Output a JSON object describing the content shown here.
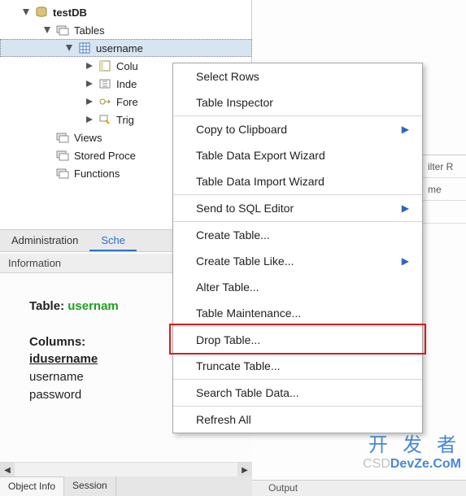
{
  "tree": {
    "db": "testDB",
    "tables_label": "Tables",
    "selected_table": "username",
    "cols": "Colu",
    "idx": "Inde",
    "fk": "Fore",
    "trig": "Trig",
    "views": "Views",
    "sp": "Stored Proce",
    "fn": "Functions"
  },
  "navtabs": {
    "admin": "Administration",
    "schemas": "Sche"
  },
  "info": {
    "header": "Information",
    "table_lbl": "Table: ",
    "table_val": "usernam",
    "cols_lbl": "Columns:",
    "cols": [
      "idusername",
      "username",
      "password"
    ]
  },
  "bottom_tabs": {
    "objinfo": "Object Info",
    "session": "Session"
  },
  "right": {
    "filter": "ilter R",
    "col": "me",
    "output": "Output"
  },
  "menu": {
    "items": [
      {
        "id": "select-rows",
        "label": "Select Rows",
        "sep": false
      },
      {
        "id": "table-inspector",
        "label": "Table Inspector",
        "sep": true
      },
      {
        "id": "copy-clip",
        "label": "Copy to Clipboard",
        "sub": true,
        "sep": false
      },
      {
        "id": "export-wiz",
        "label": "Table Data Export Wizard",
        "sep": false
      },
      {
        "id": "import-wiz",
        "label": "Table Data Import Wizard",
        "sep": true
      },
      {
        "id": "send-sql",
        "label": "Send to SQL Editor",
        "sub": true,
        "sep": true
      },
      {
        "id": "create-table",
        "label": "Create Table...",
        "sep": false
      },
      {
        "id": "create-like",
        "label": "Create Table Like...",
        "sub": true,
        "sep": false
      },
      {
        "id": "alter-table",
        "label": "Alter Table...",
        "sep": false
      },
      {
        "id": "maintenance",
        "label": "Table Maintenance...",
        "sep": true
      },
      {
        "id": "drop-table",
        "label": "Drop Table...",
        "sep": false,
        "highlight": true
      },
      {
        "id": "truncate-table",
        "label": "Truncate Table...",
        "sep": true
      },
      {
        "id": "search-data",
        "label": "Search Table Data...",
        "sep": true
      },
      {
        "id": "refresh-all",
        "label": "Refresh All",
        "sep": false
      }
    ]
  },
  "watermark": {
    "l1": "开 发 者",
    "l2a": "CSD",
    "l2b": "DevZe.CoM"
  }
}
